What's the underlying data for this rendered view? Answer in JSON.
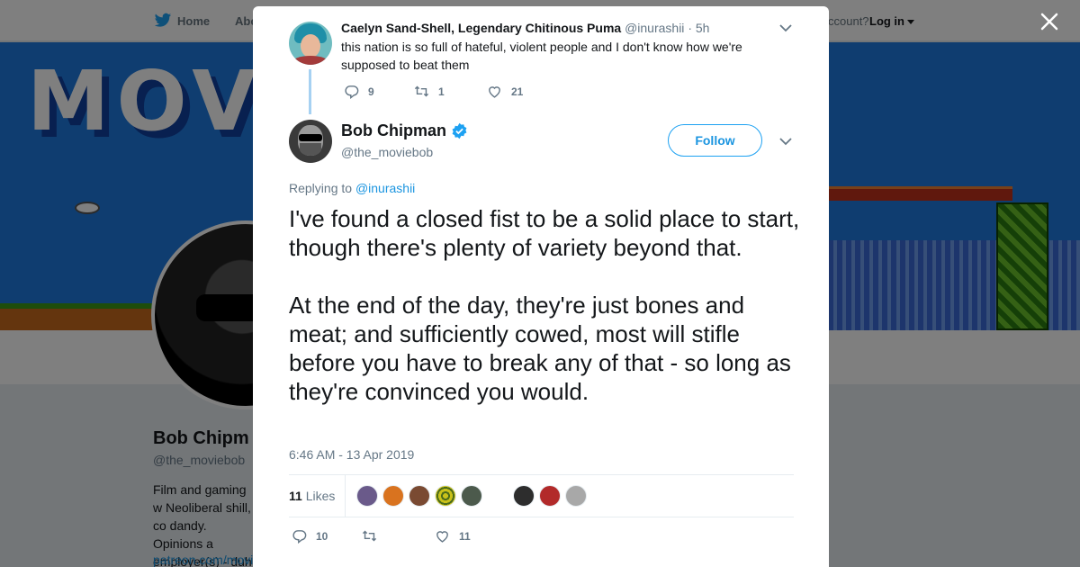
{
  "nav": {
    "home_label": "Home",
    "about_label": "Abo",
    "account_text": "ccount?",
    "login_label": "Log in"
  },
  "background_profile": {
    "banner_text": "MOVI",
    "name": "Bob Chipm",
    "handle": "@the_moviebob",
    "bio": "Film and gaming w Neoliberal shill, co dandy. Opinions a employer(s) - duh",
    "link": "patreon.com/movi"
  },
  "parent_tweet": {
    "name": "Caelyn Sand-Shell, Legendary Chitinous Puma",
    "handle": "@inurashii",
    "time": "· 5h",
    "text": "this nation is so full of hateful, violent people and I don't know how we're supposed to beat them",
    "replies": "9",
    "retweets": "1",
    "likes": "21"
  },
  "main_tweet": {
    "name": "Bob Chipman",
    "handle": "@the_moviebob",
    "follow_label": "Follow",
    "replying_prefix": "Replying to",
    "replying_handle": "@inurashii",
    "text_p1": "I've found a closed fist to be a solid place to start, though there's plenty of variety beyond that.",
    "text_p2": "At the end of the day, they're just bones and meat; and sufficiently cowed, most will stifle before you have to break any of that - so long as they're convinced you would.",
    "timestamp": "6:46 AM - 13 Apr 2019",
    "likes_number": "11",
    "likes_word": "Likes",
    "reply_count": "10",
    "like_count": "11"
  },
  "colors": {
    "accent": "#1da1f2",
    "link": "#1b95e0",
    "muted": "#657786",
    "text": "#14171a",
    "overlay": "rgba(0,0,0,0.5)"
  },
  "icons": [
    "twitter-bird-icon",
    "close-icon",
    "chevron-down-icon",
    "reply-icon",
    "retweet-icon",
    "heart-icon",
    "verified-badge-icon"
  ],
  "liker_avatar_colors": [
    "#6a5a8a",
    "#d9731f",
    "#7a4a32",
    "#c9c11a",
    "#4c5a4c",
    "#2d2d2d",
    "#b22a2a",
    "#a8a8a8"
  ]
}
